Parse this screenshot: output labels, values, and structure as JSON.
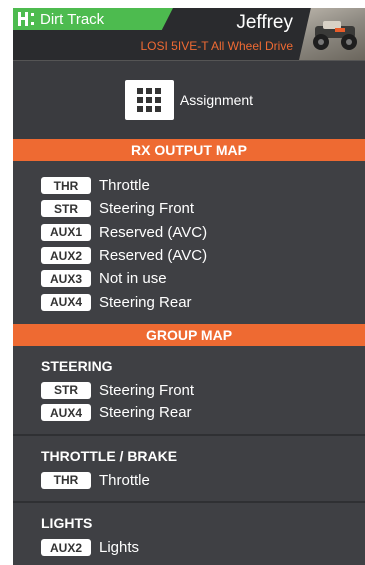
{
  "header": {
    "track_label": "Dirt Track",
    "user_name": "Jeffrey",
    "model_name": "LOSI 5IVE-T All Wheel Drive"
  },
  "assignment": {
    "label": "Assignment"
  },
  "rx_output_map": {
    "title": "RX OUTPUT MAP",
    "rows": [
      {
        "tag": "THR",
        "label": "Throttle"
      },
      {
        "tag": "STR",
        "label": "Steering Front"
      },
      {
        "tag": "AUX1",
        "label": "Reserved (AVC)"
      },
      {
        "tag": "AUX2",
        "label": "Reserved (AVC)"
      },
      {
        "tag": "AUX3",
        "label": "Not in use"
      },
      {
        "tag": "AUX4",
        "label": "Steering Rear"
      }
    ]
  },
  "group_map": {
    "title": "GROUP MAP",
    "groups": [
      {
        "title": "STEERING",
        "rows": [
          {
            "tag": "STR",
            "label": "Steering Front"
          },
          {
            "tag": "AUX4",
            "label": "Steering Rear"
          }
        ]
      },
      {
        "title": "THROTTLE / BRAKE",
        "rows": [
          {
            "tag": "THR",
            "label": "Throttle"
          }
        ]
      },
      {
        "title": "LIGHTS",
        "rows": [
          {
            "tag": "AUX2",
            "label": "Lights"
          }
        ]
      }
    ]
  },
  "colors": {
    "accent": "#ee6a32",
    "track_tab": "#4dbb4f",
    "background": "#3f4044"
  }
}
